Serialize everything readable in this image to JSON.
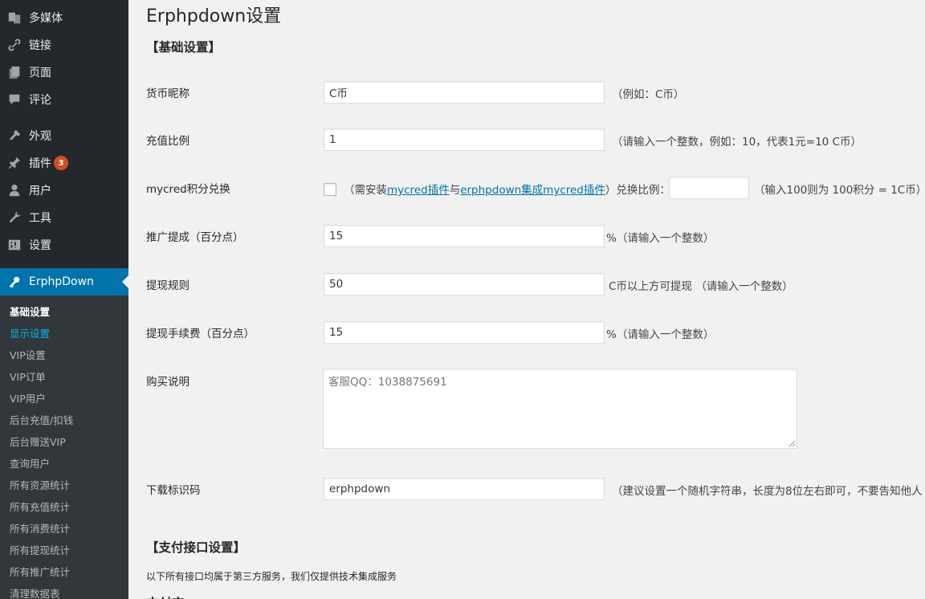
{
  "sidebar": {
    "items": [
      {
        "label": "多媒体",
        "icon": "media-icon"
      },
      {
        "label": "链接",
        "icon": "link-icon"
      },
      {
        "label": "页面",
        "icon": "page-icon"
      },
      {
        "label": "评论",
        "icon": "comment-icon"
      },
      {
        "label": "外观",
        "icon": "appearance-icon"
      },
      {
        "label": "插件",
        "icon": "plugin-icon",
        "badge": "3"
      },
      {
        "label": "用户",
        "icon": "user-icon"
      },
      {
        "label": "工具",
        "icon": "wrench-icon"
      },
      {
        "label": "设置",
        "icon": "settings-icon"
      },
      {
        "label": "ErphpDown",
        "icon": "key-icon",
        "active": true
      }
    ],
    "submenu": [
      "基础设置",
      "显示设置",
      "VIP设置",
      "VIP订单",
      "VIP用户",
      "后台充值/扣钱",
      "后台赠送VIP",
      "查询用户",
      "所有资源统计",
      "所有充值统计",
      "所有消费统计",
      "所有提现统计",
      "所有推广统计",
      "清理数据表"
    ],
    "accent_color": "#0073aa",
    "badge_color": "#d54e21"
  },
  "main": {
    "title": "Erphpdown设置",
    "section_basic": "【基础设置】",
    "fields": {
      "currency_name": {
        "label": "货币昵称",
        "value": "C币",
        "desc": "（例如：C币）"
      },
      "ratio": {
        "label": "充值比例",
        "value": "1",
        "desc": "（请输入一个整数，例如：10，代表1元=10 C币）"
      },
      "mycred": {
        "label": "mycred积分兑换",
        "desc_prefix": "（需安装",
        "link1": "mycred插件",
        "desc_mid": "与",
        "link2": "erphpdown集成mycred插件",
        "desc_suffix": "）兑换比例：",
        "desc_after": "（输入100则为 100积分 = 1C币）"
      },
      "commission": {
        "label": "推广提成（百分点）",
        "value": "15",
        "desc": "%（请输入一个整数）"
      },
      "withdraw_rule": {
        "label": "提现规则",
        "value": "50",
        "desc": "C币以上方可提现 （请输入一个整数）"
      },
      "withdraw_fee": {
        "label": "提现手续费（百分点）",
        "value": "15",
        "desc": "%（请输入一个整数）"
      },
      "purchase_desc": {
        "label": "购买说明",
        "value": "客服QQ：1038875691"
      },
      "download_code": {
        "label": "下载标识码",
        "value": "erphpdown",
        "desc": "（建议设置一个随机字符串，长度为8位左右即可，不要告知他人"
      }
    },
    "section_payment": "【支付接口设置】",
    "payment_note": "以下所有接口均属于第三方服务，我们仅提供技术集成服务",
    "next_heading": "支付宝"
  }
}
